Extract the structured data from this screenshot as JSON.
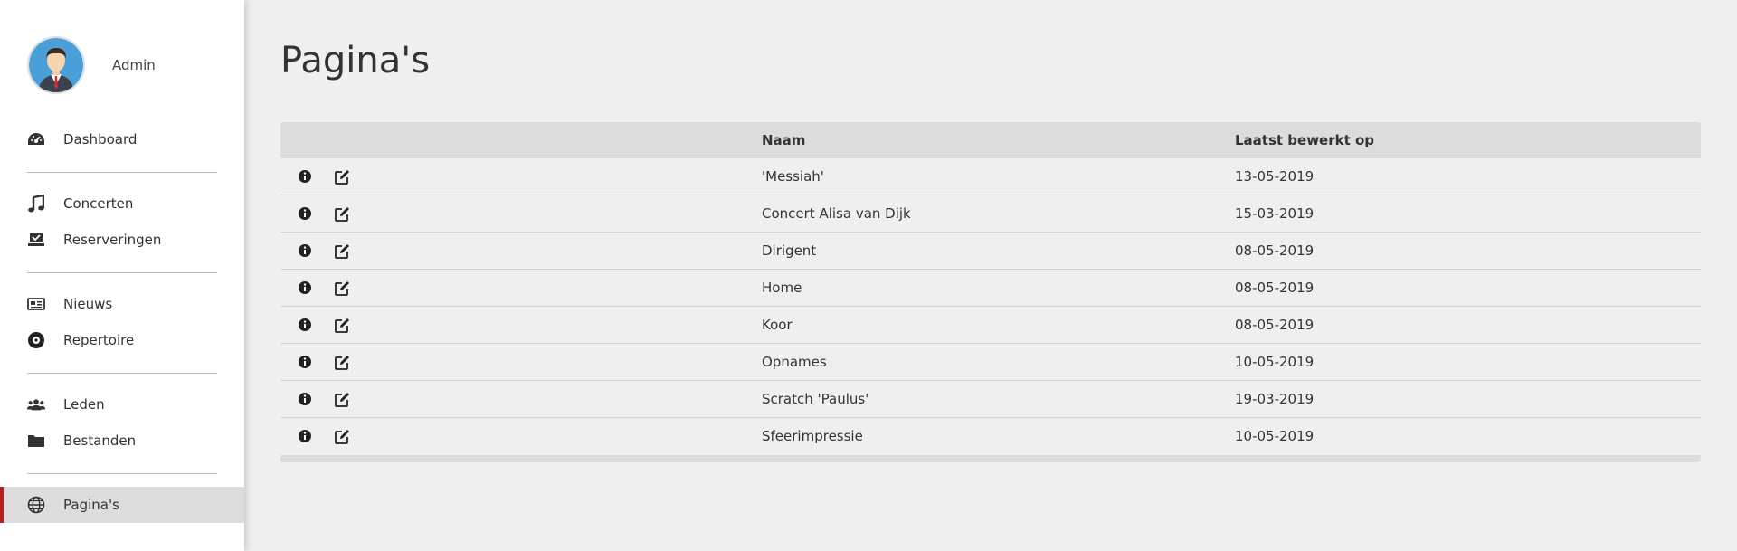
{
  "user": {
    "name": "Admin"
  },
  "sidebar": {
    "items": [
      {
        "label": "Dashboard",
        "icon": "tachometer-icon"
      },
      {
        "label": "Concerten",
        "icon": "music-icon"
      },
      {
        "label": "Reserveringen",
        "icon": "check-box-icon"
      },
      {
        "label": "Nieuws",
        "icon": "newspaper-icon"
      },
      {
        "label": "Repertoire",
        "icon": "record-icon"
      },
      {
        "label": "Leden",
        "icon": "users-icon"
      },
      {
        "label": "Bestanden",
        "icon": "folder-icon"
      },
      {
        "label": "Pagina's",
        "icon": "globe-icon",
        "active": true
      }
    ]
  },
  "main": {
    "title": "Pagina's",
    "table": {
      "headers": {
        "name": "Naam",
        "edited": "Laatst bewerkt op"
      },
      "rows": [
        {
          "name": "'Messiah'",
          "edited": "13-05-2019"
        },
        {
          "name": "Concert Alisa van Dijk",
          "edited": "15-03-2019"
        },
        {
          "name": "Dirigent",
          "edited": "08-05-2019"
        },
        {
          "name": "Home",
          "edited": "08-05-2019"
        },
        {
          "name": "Koor",
          "edited": "08-05-2019"
        },
        {
          "name": "Opnames",
          "edited": "10-05-2019"
        },
        {
          "name": "Scratch 'Paulus'",
          "edited": "19-03-2019"
        },
        {
          "name": "Sfeerimpressie",
          "edited": "10-05-2019"
        }
      ]
    }
  },
  "colors": {
    "accent": "#b22222",
    "sidebar_bg": "#ffffff",
    "page_bg": "#efefef",
    "header_bg": "#dcdcdc"
  }
}
